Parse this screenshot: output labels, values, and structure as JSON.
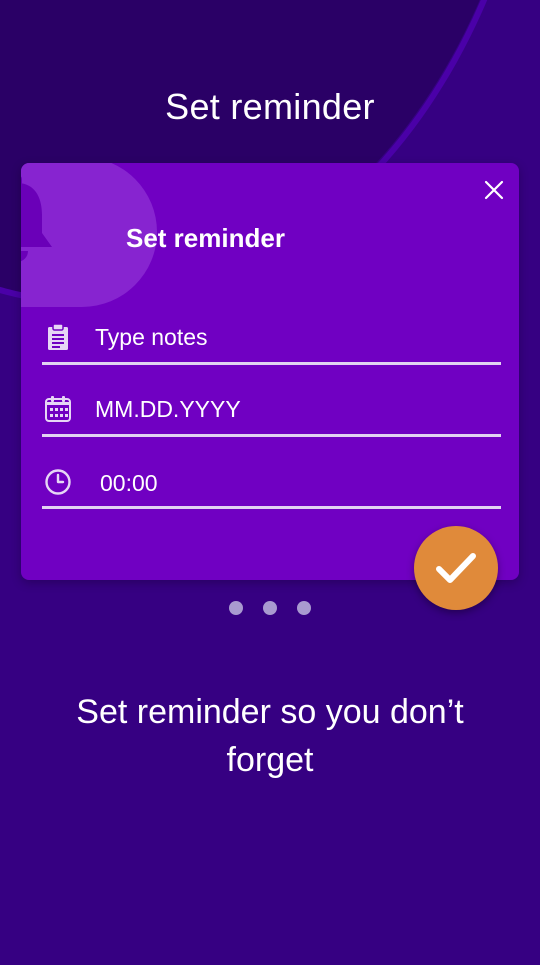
{
  "header": {
    "title": "Set reminder"
  },
  "card": {
    "title": "Set reminder",
    "fields": {
      "notes_placeholder": "Type notes",
      "date_placeholder": "MM.DD.YYYY",
      "time_value": "00:00"
    }
  },
  "pagination": {
    "count": 3
  },
  "caption": "Set reminder so you don’t forget",
  "colors": {
    "background": "#360082",
    "card": "#7000c2",
    "accent": "#e08a3a",
    "field_underline": "#e2d3f2"
  },
  "icons": [
    "bell-icon",
    "close-icon",
    "clipboard-icon",
    "calendar-icon",
    "clock-icon",
    "check-icon"
  ]
}
